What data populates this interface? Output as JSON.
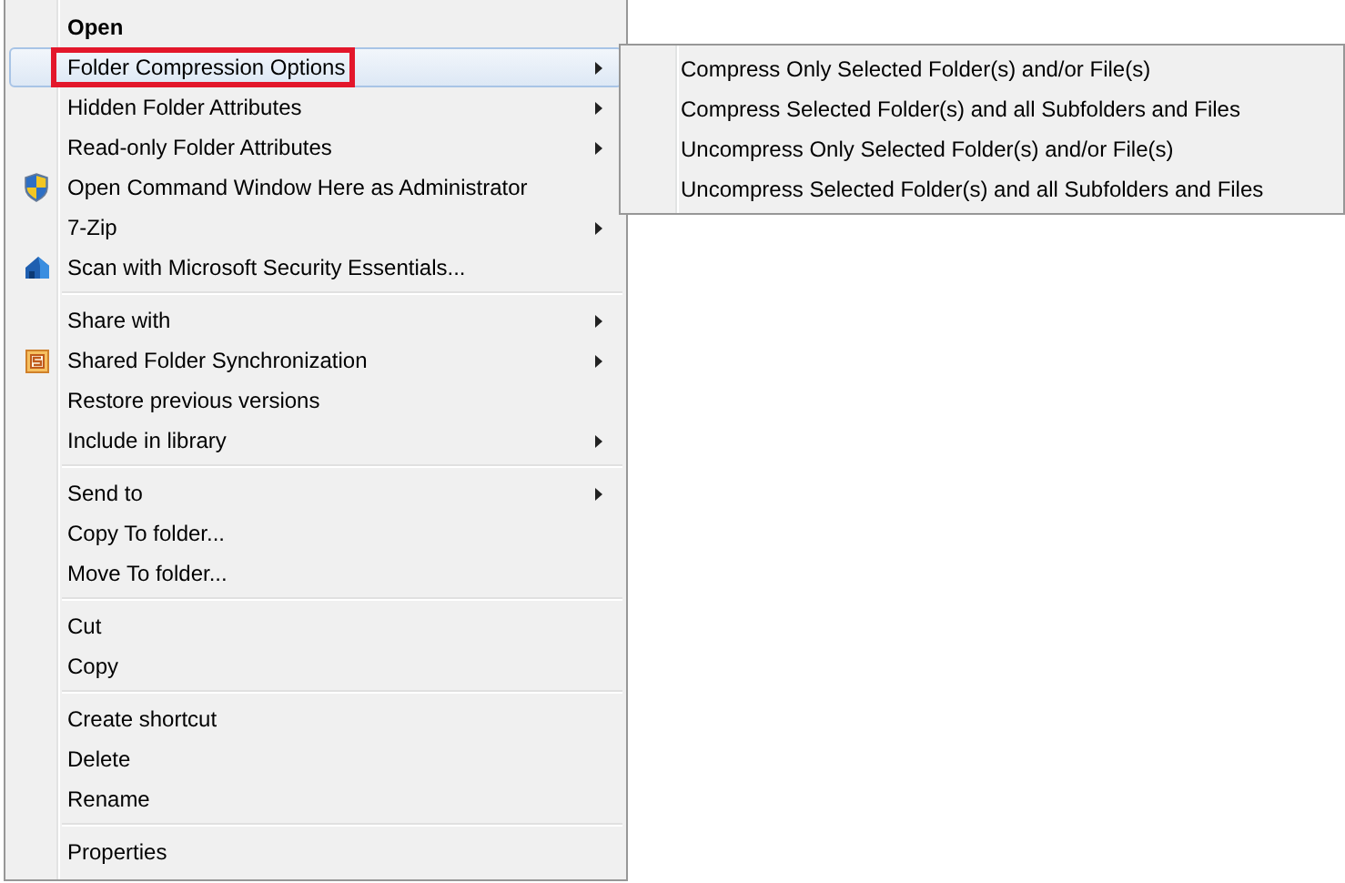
{
  "menu": {
    "groups": [
      [
        {
          "label": "Open",
          "kind": "plain",
          "bold": true,
          "submenu": false,
          "selected": false
        },
        {
          "label": "Folder Compression Options",
          "kind": "plain",
          "bold": false,
          "submenu": true,
          "selected": true,
          "annotated": true
        },
        {
          "label": "Hidden Folder Attributes",
          "kind": "plain",
          "bold": false,
          "submenu": true,
          "selected": false
        },
        {
          "label": "Read-only Folder Attributes",
          "kind": "plain",
          "bold": false,
          "submenu": true,
          "selected": false
        },
        {
          "label": "Open Command Window Here as Administrator",
          "kind": "shield",
          "bold": false,
          "submenu": false,
          "selected": false
        },
        {
          "label": "7-Zip",
          "kind": "plain",
          "bold": false,
          "submenu": true,
          "selected": false
        },
        {
          "label": "Scan with Microsoft Security Essentials...",
          "kind": "house",
          "bold": false,
          "submenu": false,
          "selected": false
        }
      ],
      [
        {
          "label": "Share with",
          "kind": "plain",
          "bold": false,
          "submenu": true,
          "selected": false
        },
        {
          "label": "Shared Folder Synchronization",
          "kind": "sync",
          "bold": false,
          "submenu": true,
          "selected": false
        },
        {
          "label": "Restore previous versions",
          "kind": "plain",
          "bold": false,
          "submenu": false,
          "selected": false
        },
        {
          "label": "Include in library",
          "kind": "plain",
          "bold": false,
          "submenu": true,
          "selected": false
        }
      ],
      [
        {
          "label": "Send to",
          "kind": "plain",
          "bold": false,
          "submenu": true,
          "selected": false
        },
        {
          "label": "Copy To folder...",
          "kind": "plain",
          "bold": false,
          "submenu": false,
          "selected": false
        },
        {
          "label": "Move To folder...",
          "kind": "plain",
          "bold": false,
          "submenu": false,
          "selected": false
        }
      ],
      [
        {
          "label": "Cut",
          "kind": "plain",
          "bold": false,
          "submenu": false,
          "selected": false
        },
        {
          "label": "Copy",
          "kind": "plain",
          "bold": false,
          "submenu": false,
          "selected": false
        }
      ],
      [
        {
          "label": "Create shortcut",
          "kind": "plain",
          "bold": false,
          "submenu": false,
          "selected": false
        },
        {
          "label": "Delete",
          "kind": "plain",
          "bold": false,
          "submenu": false,
          "selected": false
        },
        {
          "label": "Rename",
          "kind": "plain",
          "bold": false,
          "submenu": false,
          "selected": false
        }
      ],
      [
        {
          "label": "Properties",
          "kind": "plain",
          "bold": false,
          "submenu": false,
          "selected": false
        }
      ]
    ]
  },
  "submenu": {
    "items": [
      {
        "label": "Compress Only Selected Folder(s) and/or File(s)"
      },
      {
        "label": "Compress Selected Folder(s) and all Subfolders and Files"
      },
      {
        "label": "Uncompress Only Selected Folder(s) and/or File(s)"
      },
      {
        "label": "Uncompress Selected Folder(s) and all Subfolders and Files"
      }
    ]
  }
}
